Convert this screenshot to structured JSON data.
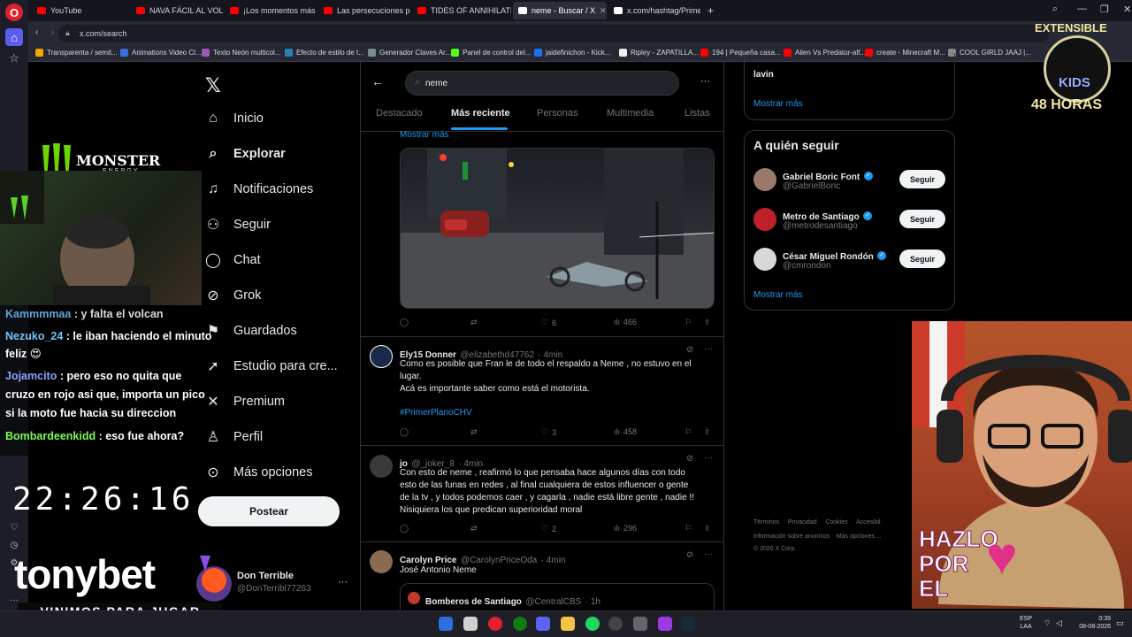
{
  "browser": {
    "tabs": [
      {
        "label": "YouTube",
        "fav": "#ff0000"
      },
      {
        "label": "NAVA FÁCIL AL VOLANTE",
        "fav": "#ff0000"
      },
      {
        "label": "¡Los momentos más incre",
        "fav": "#ff0000"
      },
      {
        "label": "Las persecuciones policial",
        "fav": "#ff0000"
      },
      {
        "label": "TIDES OF ANNIHILATION",
        "fav": "#ff0000"
      },
      {
        "label": "neme - Buscar / X",
        "fav": "#ffffff"
      },
      {
        "label": "x.com/hashtag/PrimerPla",
        "fav": "#ffffff"
      }
    ],
    "url": "x.com/search",
    "bookmarks": [
      "Transparenta / semit...",
      "Animations Video Cl...",
      "Texto Neón multicol...",
      "Efecto de estilo de t...",
      "Generador Claves Ar...",
      "Panel de control del...",
      "jaidefinichon - Kick...",
      "Ripley - ZAPATILLA...",
      "194 | Pequeña casa...",
      "Alien Vs Predator-alf...",
      "create - Minecraft M...",
      "COOL GIRLD JAAJ |..."
    ]
  },
  "nav": {
    "items": [
      {
        "label": "Inicio",
        "icon": "home-icon"
      },
      {
        "label": "Explorar",
        "icon": "search-icon"
      },
      {
        "label": "Notificaciones",
        "icon": "bell-icon"
      },
      {
        "label": "Seguir",
        "icon": "add-user-icon"
      },
      {
        "label": "Chat",
        "icon": "chat-icon"
      },
      {
        "label": "Grok",
        "icon": "grok-icon"
      },
      {
        "label": "Guardados",
        "icon": "bookmark-icon"
      },
      {
        "label": "Estudio para cre...",
        "icon": "rocket-icon"
      },
      {
        "label": "Premium",
        "icon": "x-icon"
      },
      {
        "label": "Perfil",
        "icon": "user-icon"
      },
      {
        "label": "Más opciones",
        "icon": "more-icon"
      }
    ],
    "post_label": "Postear",
    "account_name": "Don Terrible",
    "account_handle": "@DonTerribl77263"
  },
  "search": {
    "query": "neme",
    "tabs": [
      "Destacado",
      "Más reciente",
      "Personas",
      "Multimedia",
      "Listas"
    ],
    "show_more": "Mostrar más"
  },
  "posts": [
    {
      "stats": {
        "reply": "",
        "repost": "",
        "like": "6",
        "views": "466"
      }
    },
    {
      "name": "Ely15 Donner",
      "handle": "@elizabethd47762",
      "time": "· 4min",
      "text_lines": [
        "Como es posible que Fran le de todo el respaldo a Neme , no estuvo en el",
        "lugar.",
        "Acá es importante saber como está el motorista."
      ],
      "hashtag": "#PrimerPlanoCHV",
      "stats": {
        "like": "3",
        "views": "458"
      }
    },
    {
      "name": "jo",
      "handle": "@_joker_8",
      "time": "· 4min",
      "text_lines": [
        "Con esto de neme , reafirmó lo que pensaba hace algunos días con todo",
        "esto de las funas en redes , al final cualquiera de estos influencer o gente",
        "de la tv , y todos podemos caer , y cagarla , nadie está libre gente , nadie !!",
        "Nisiquiera los que predican superioridad moral"
      ],
      "stats": {
        "like": "2",
        "views": "296"
      }
    },
    {
      "name": "Carolyn Price",
      "handle": "@CarolynPriceOda",
      "time": "· 4min",
      "text_lines": [
        "José Antonio Neme"
      ],
      "quote_name": "Bomberos de Santiago",
      "quote_handle": "@CentralCBS",
      "quote_time": "· 1h"
    }
  ],
  "right": {
    "top_item": "lavin",
    "show_more": "Mostrar más",
    "who_to_follow_title": "A quién seguir",
    "suggestions": [
      {
        "name": "Gabriel Boric Font",
        "handle": "@GabrielBoric",
        "button": "Seguir"
      },
      {
        "name": "Metro de Santiago",
        "handle": "@metrodesantiago",
        "button": "Seguir"
      },
      {
        "name": "César Miguel Rondón",
        "handle": "@cmrondon",
        "button": "Seguir"
      }
    ],
    "footer": [
      "Términos",
      "Privacidad",
      "Cookies",
      "Accesibil",
      "Información sobre anuncios",
      "Más opciones ...",
      "© 2026 X Corp."
    ]
  },
  "stream": {
    "chat": [
      {
        "user": "Kammmmaa",
        "msg": ": y falta el volcan",
        "color": "#ffffff"
      },
      {
        "user": "Nezuko_24",
        "msg": ": le iban haciendo el minuto",
        "color": "#6fc3ff"
      },
      {
        "user": "",
        "msg": "feliz 😍",
        "color": "#ffffff"
      },
      {
        "user": "Jojamcito",
        "msg": ": pero eso no quita que",
        "color": "#8aa2ff"
      },
      {
        "user": "",
        "msg": "cruzo en rojo asi que, importa un pico",
        "color": "#ffffff"
      },
      {
        "user": "",
        "msg": "si la moto fue hacia su direccion",
        "color": "#ffffff"
      },
      {
        "user": "Bombardeenkidd",
        "msg": ": eso fue ahora?",
        "color": "#7cfc52"
      }
    ],
    "clock": "22:26:16",
    "sponsor": "tonybet",
    "slogan": "VINIMOS PARA JUGAR",
    "badge_top": "EXTENSIBLE",
    "badge_mid": "KIDS",
    "badge_bottom": "48 HORAS",
    "monster": "MONSTER",
    "monster_sub": "ENERGY",
    "hazlo": [
      "HAZLO",
      "POR",
      "EL"
    ]
  },
  "taskbar": {
    "lang": "ESP",
    "lang_sub": "LAA",
    "time": "0:39",
    "date": "08-08-2026"
  }
}
